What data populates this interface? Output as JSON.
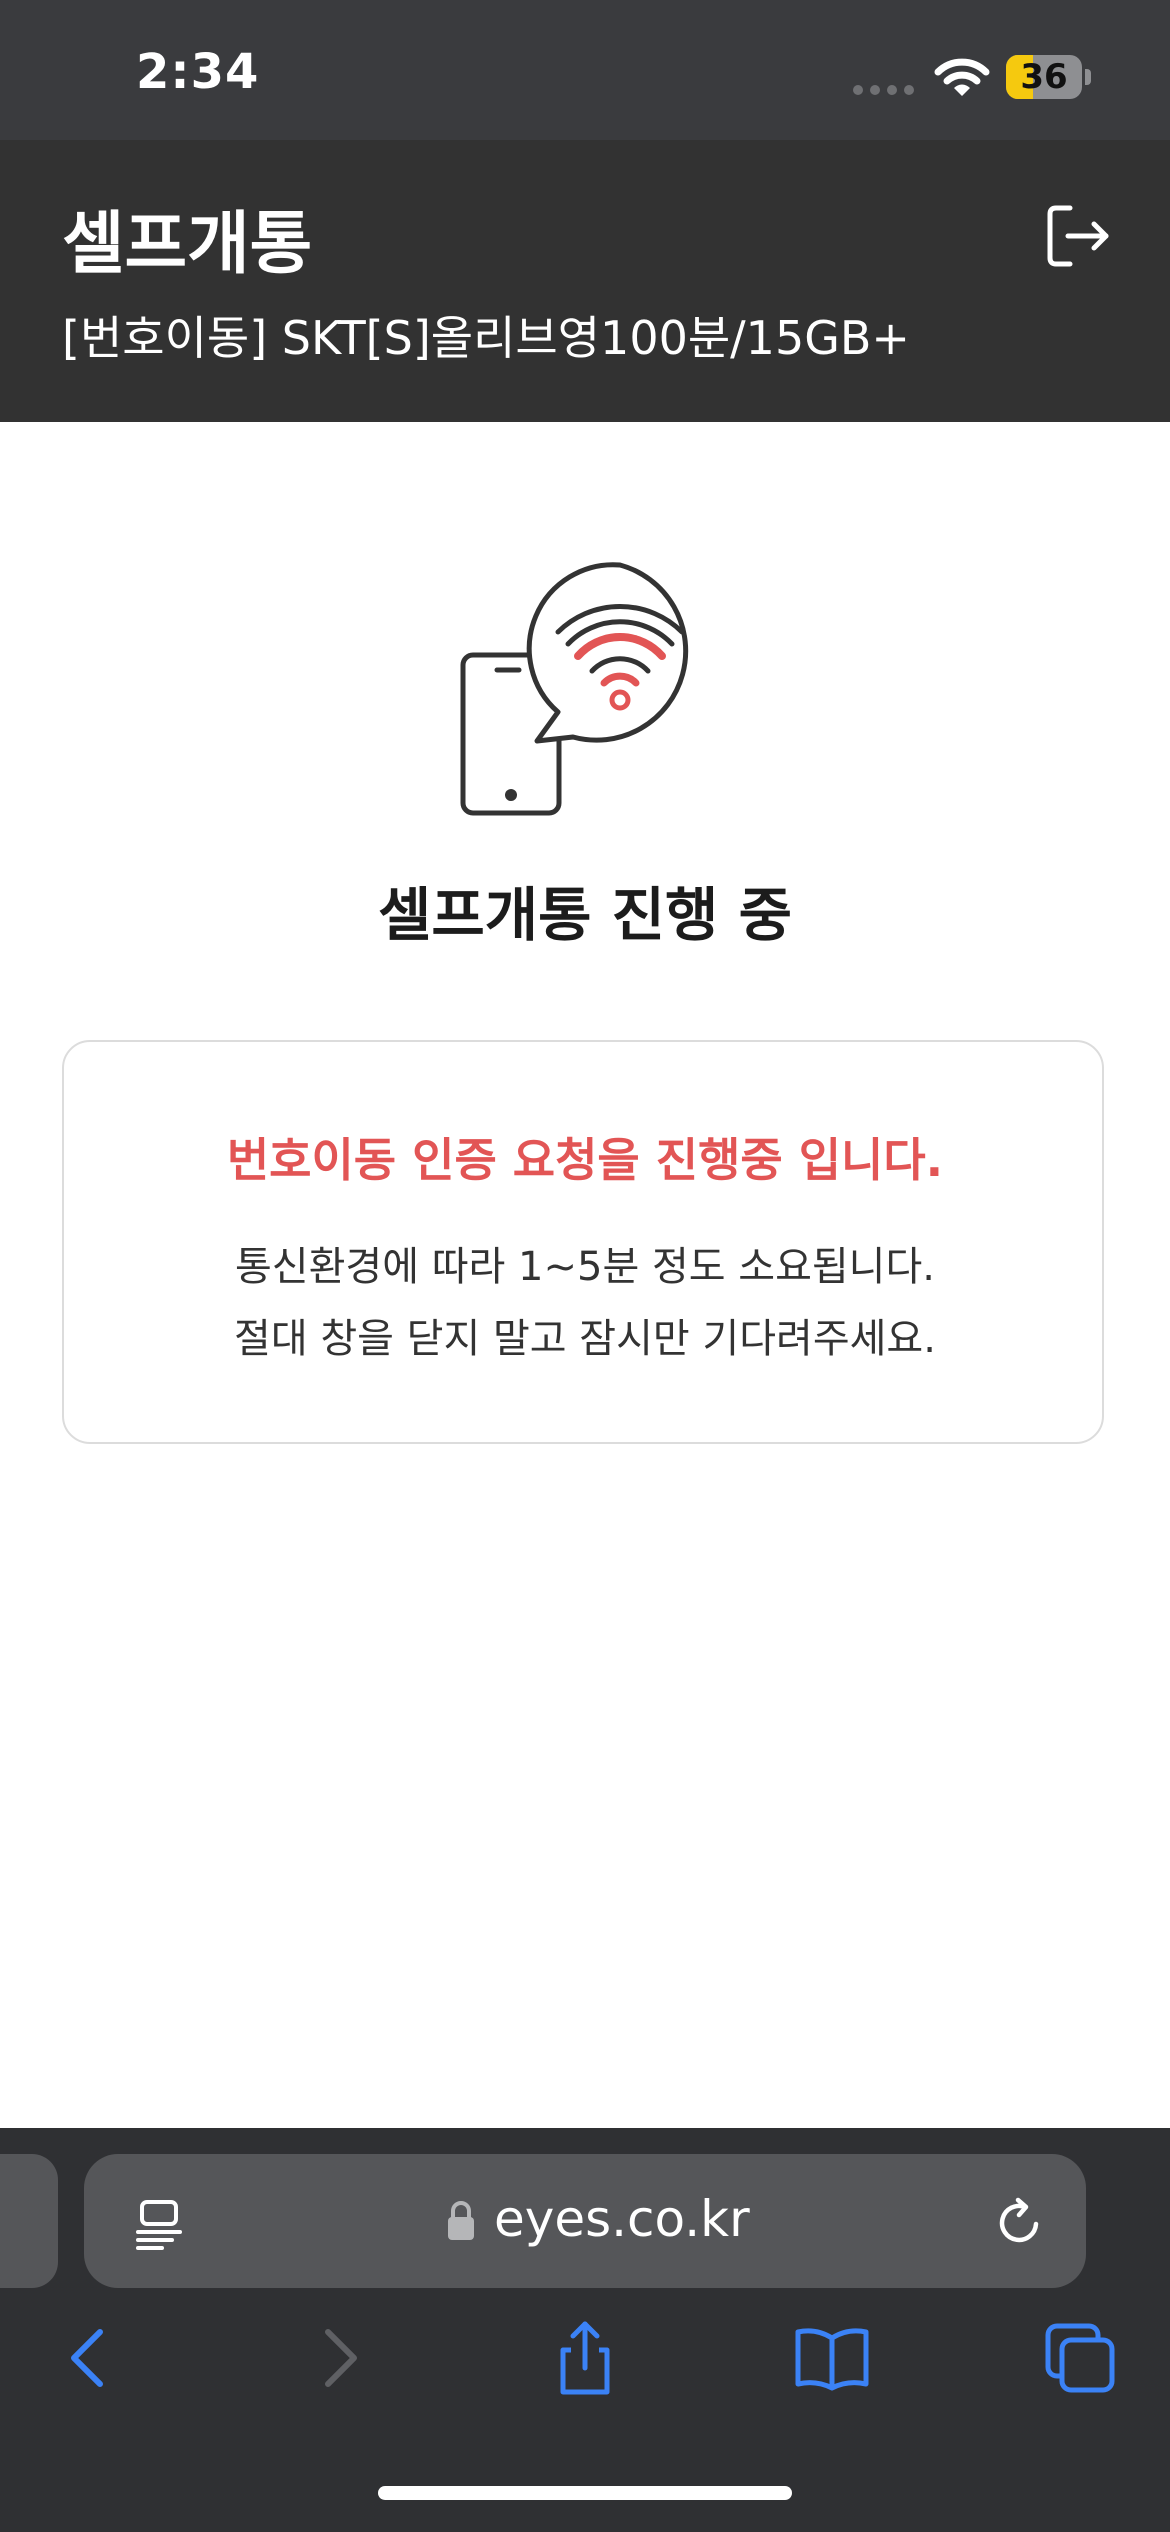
{
  "status_bar": {
    "time": "2:34",
    "battery_level": "36",
    "battery_fraction": 0.36
  },
  "header": {
    "title": "셀프개통",
    "subtitle": "[번호이동] SKT[S]올리브영100분/15GB+",
    "logout_icon": "logout-icon"
  },
  "main": {
    "illustration_icon": "phone-wifi-icon",
    "progress_title": "셀프개통 진행 중",
    "message": {
      "headline": "번호이동 인증 요청을 진행중 입니다.",
      "line1": "통신환경에 따라 1~5분 정도 소요됩니다.",
      "line2": "절대 창을 닫지 말고 잠시만 기다려주세요."
    }
  },
  "browser": {
    "url": "eyes.co.kr",
    "reader_icon": "reader-icon",
    "lock_icon": "lock-icon",
    "reload_icon": "reload-icon",
    "toolbar": [
      {
        "icon": "back-icon",
        "enabled": true
      },
      {
        "icon": "forward-icon",
        "enabled": false
      },
      {
        "icon": "share-icon",
        "enabled": true
      },
      {
        "icon": "bookmarks-icon",
        "enabled": true
      },
      {
        "icon": "tabs-icon",
        "enabled": true
      }
    ]
  },
  "colors": {
    "header_bg": "#323232",
    "accent_red": "#e25555",
    "toolbar_blue": "#3b82f6",
    "battery_yellow": "#f5c90f"
  }
}
